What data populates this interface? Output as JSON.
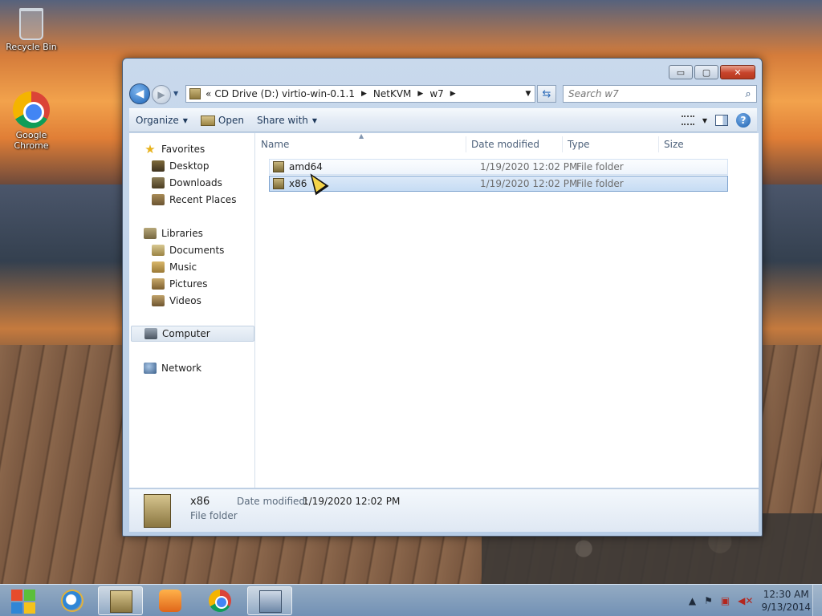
{
  "desktop": {
    "icons": [
      {
        "label": "Recycle Bin",
        "icon": "recycle-bin-icon"
      },
      {
        "label": "Google Chrome",
        "icon": "chrome-icon"
      }
    ]
  },
  "window": {
    "title": "w7",
    "controls": {
      "minimize": "▭",
      "maximize": "▢",
      "close": "✕"
    },
    "address": {
      "crumbs": [
        "CD Drive (D:) virtio-win-0.1.1",
        "NetKVM",
        "w7"
      ],
      "overflow": "«"
    },
    "search": {
      "placeholder": "Search w7",
      "value": ""
    },
    "toolbar": {
      "organize": "Organize",
      "open": "Open",
      "share_with": "Share with"
    },
    "nav": {
      "favorites": "Favorites",
      "desktop": "Desktop",
      "downloads": "Downloads",
      "recent": "Recent Places",
      "libraries": "Libraries",
      "documents": "Documents",
      "music": "Music",
      "pictures": "Pictures",
      "videos": "Videos",
      "computer": "Computer",
      "network": "Network"
    },
    "columns": {
      "name": "Name",
      "date": "Date modified",
      "type": "Type",
      "size": "Size"
    },
    "files": [
      {
        "name": "amd64",
        "date": "1/19/2020 12:02 PM",
        "type": "File folder",
        "size": ""
      },
      {
        "name": "x86",
        "date": "1/19/2020 12:02 PM",
        "type": "File folder",
        "size": ""
      }
    ],
    "details": {
      "name": "x86",
      "type": "File folder",
      "date_label": "Date modified:",
      "date_value": "1/19/2020 12:02 PM"
    }
  },
  "taskbar": {
    "apps": [
      "internet-explorer-icon",
      "windows-explorer-icon",
      "media-player-icon",
      "chrome-icon",
      "setup-icon"
    ],
    "clock": {
      "time": "12:30 AM",
      "date": "9/13/2014"
    }
  }
}
